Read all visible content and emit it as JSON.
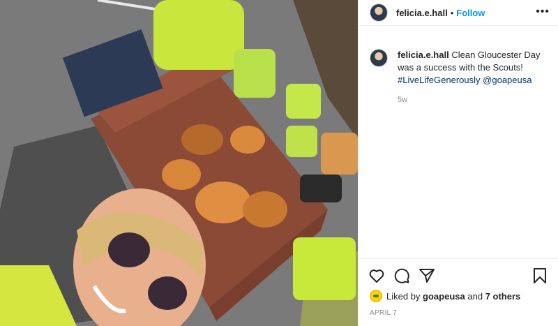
{
  "header": {
    "username": "felicia.e.hall",
    "separator": "•",
    "follow_label": "Follow",
    "more_icon": "more-horizontal-icon"
  },
  "caption": {
    "username": "felicia.e.hall",
    "text": "Clean Gloucester Day was a success with the Scouts!",
    "hashtag": "#LiveLifeGenerously",
    "mention": "@goapeusa",
    "time": "5w"
  },
  "actions": {
    "like_icon": "heart-icon",
    "comment_icon": "comment-icon",
    "share_icon": "share-icon",
    "save_icon": "bookmark-icon"
  },
  "likes": {
    "prefix": "Liked by",
    "user": "goapeusa",
    "and": "and",
    "others": "7 others"
  },
  "date": "APRIL 7",
  "colors": {
    "follow": "#0095f6",
    "link": "#00376b",
    "muted": "#8e8e8e",
    "border": "#efefef"
  }
}
